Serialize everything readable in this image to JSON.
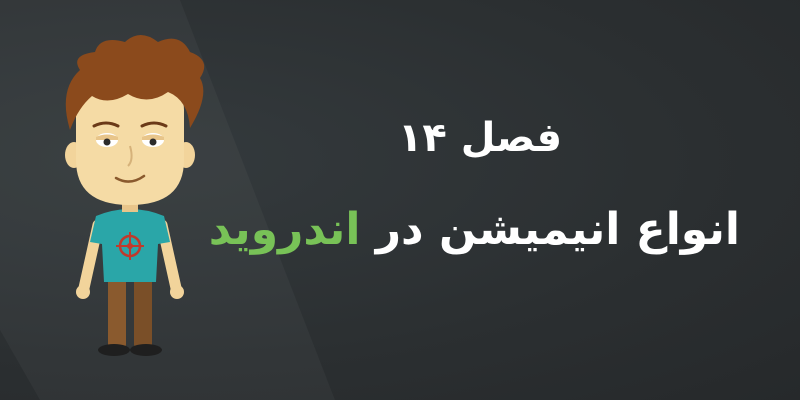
{
  "banner": {
    "chapter_label": "فصل ۱۴",
    "headline_main": "انواع انیمیشن در ",
    "headline_accent": "اندروید"
  },
  "colors": {
    "background": "#2c3033",
    "accent": "#78c257",
    "text": "#ffffff"
  },
  "icons": {
    "character": "cartoon-man-illustration",
    "shirt_emblem": "target-emblem-icon"
  }
}
